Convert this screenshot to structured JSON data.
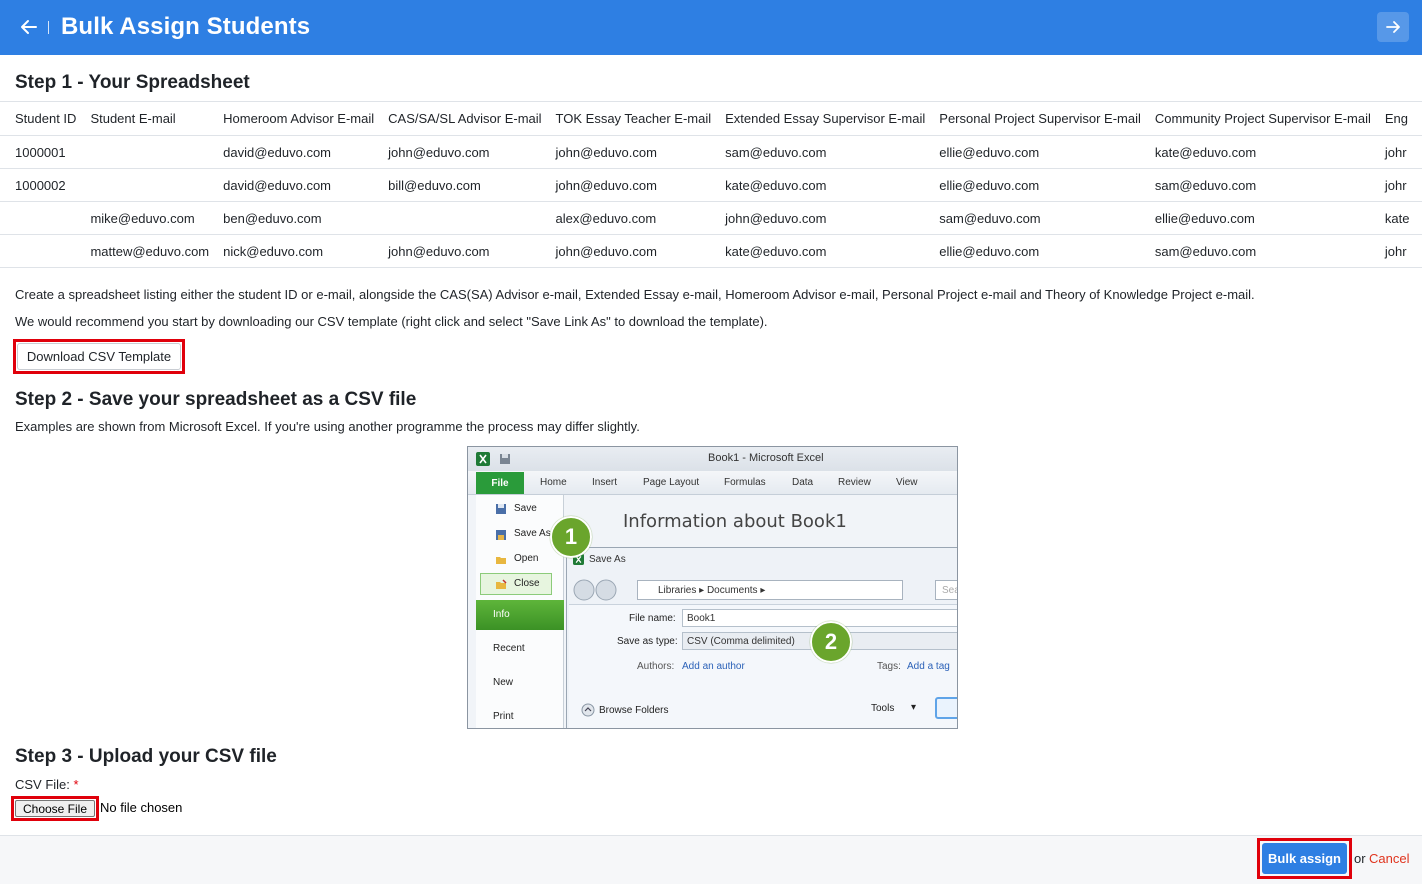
{
  "header": {
    "title": "Bulk Assign Students",
    "back_icon": "arrow-left-icon",
    "forward_icon": "arrow-right-icon",
    "color": "#2e7fe3"
  },
  "step1": {
    "heading": "Step 1 - Your Spreadsheet",
    "columns": [
      "Student ID",
      "Student E-mail",
      "Homeroom Advisor E-mail",
      "CAS/SA/SL Advisor E-mail",
      "TOK Essay Teacher E-mail",
      "Extended Essay Supervisor E-mail",
      "Personal Project Supervisor E-mail",
      "Community Project Supervisor E-mail",
      "Eng"
    ],
    "rows": [
      [
        "1000001",
        "",
        "david@eduvo.com",
        "john@eduvo.com",
        "john@eduvo.com",
        "sam@eduvo.com",
        "ellie@eduvo.com",
        "kate@eduvo.com",
        "johr"
      ],
      [
        "1000002",
        "",
        "david@eduvo.com",
        "bill@eduvo.com",
        "john@eduvo.com",
        "kate@eduvo.com",
        "ellie@eduvo.com",
        "sam@eduvo.com",
        "johr"
      ],
      [
        "",
        "mike@eduvo.com",
        "ben@eduvo.com",
        "",
        "alex@eduvo.com",
        "john@eduvo.com",
        "sam@eduvo.com",
        "ellie@eduvo.com",
        "kate"
      ],
      [
        "",
        "mattew@eduvo.com",
        "nick@eduvo.com",
        "john@eduvo.com",
        "john@eduvo.com",
        "kate@eduvo.com",
        "ellie@eduvo.com",
        "sam@eduvo.com",
        "johr"
      ]
    ],
    "instructions": "Create a spreadsheet listing either the student ID or e-mail, alongside the CAS(SA) Advisor e-mail, Extended Essay e-mail, Homeroom Advisor e-mail, Personal Project e-mail and Theory of Knowledge Project e-mail.",
    "recommendation": "We would recommend you start by downloading our CSV template (right click and select \"Save Link As\" to download the template).",
    "download_label": "Download CSV Template"
  },
  "step2": {
    "heading": "Step 2 - Save your spreadsheet as a CSV file",
    "note": "Examples are shown from Microsoft Excel. If you're using another programme the process may differ slightly.",
    "excel": {
      "window_title": "Book1 - Microsoft Excel",
      "tabs": [
        "File",
        "Home",
        "Insert",
        "Page Layout",
        "Formulas",
        "Data",
        "Review",
        "View"
      ],
      "menu": [
        "Save",
        "Save As",
        "Open",
        "Close",
        "Info",
        "Recent",
        "New",
        "Print"
      ],
      "info_title": "Information about Book1",
      "dialog_title": "Save As",
      "address": [
        "Libraries",
        "Documents"
      ],
      "search_placeholder": "Sea",
      "file_name_label": "File name:",
      "file_name": "Book1",
      "save_type_label": "Save as type:",
      "save_type": "CSV (Comma delimited)",
      "authors_label": "Authors:",
      "authors_link": "Add an author",
      "tags_label": "Tags:",
      "tags_link": "Add a tag",
      "browse_folders": "Browse Folders",
      "tools": "Tools",
      "badges": [
        "1",
        "2"
      ]
    }
  },
  "step3": {
    "heading": "Step 3 - Upload your CSV file",
    "csv_label": "CSV File:",
    "required_mark": "*",
    "choose_file": "Choose File",
    "no_file": "No file chosen"
  },
  "footer": {
    "bulk_assign": "Bulk assign",
    "or": "or",
    "cancel": "Cancel"
  },
  "highlight_color": "#e0000b"
}
